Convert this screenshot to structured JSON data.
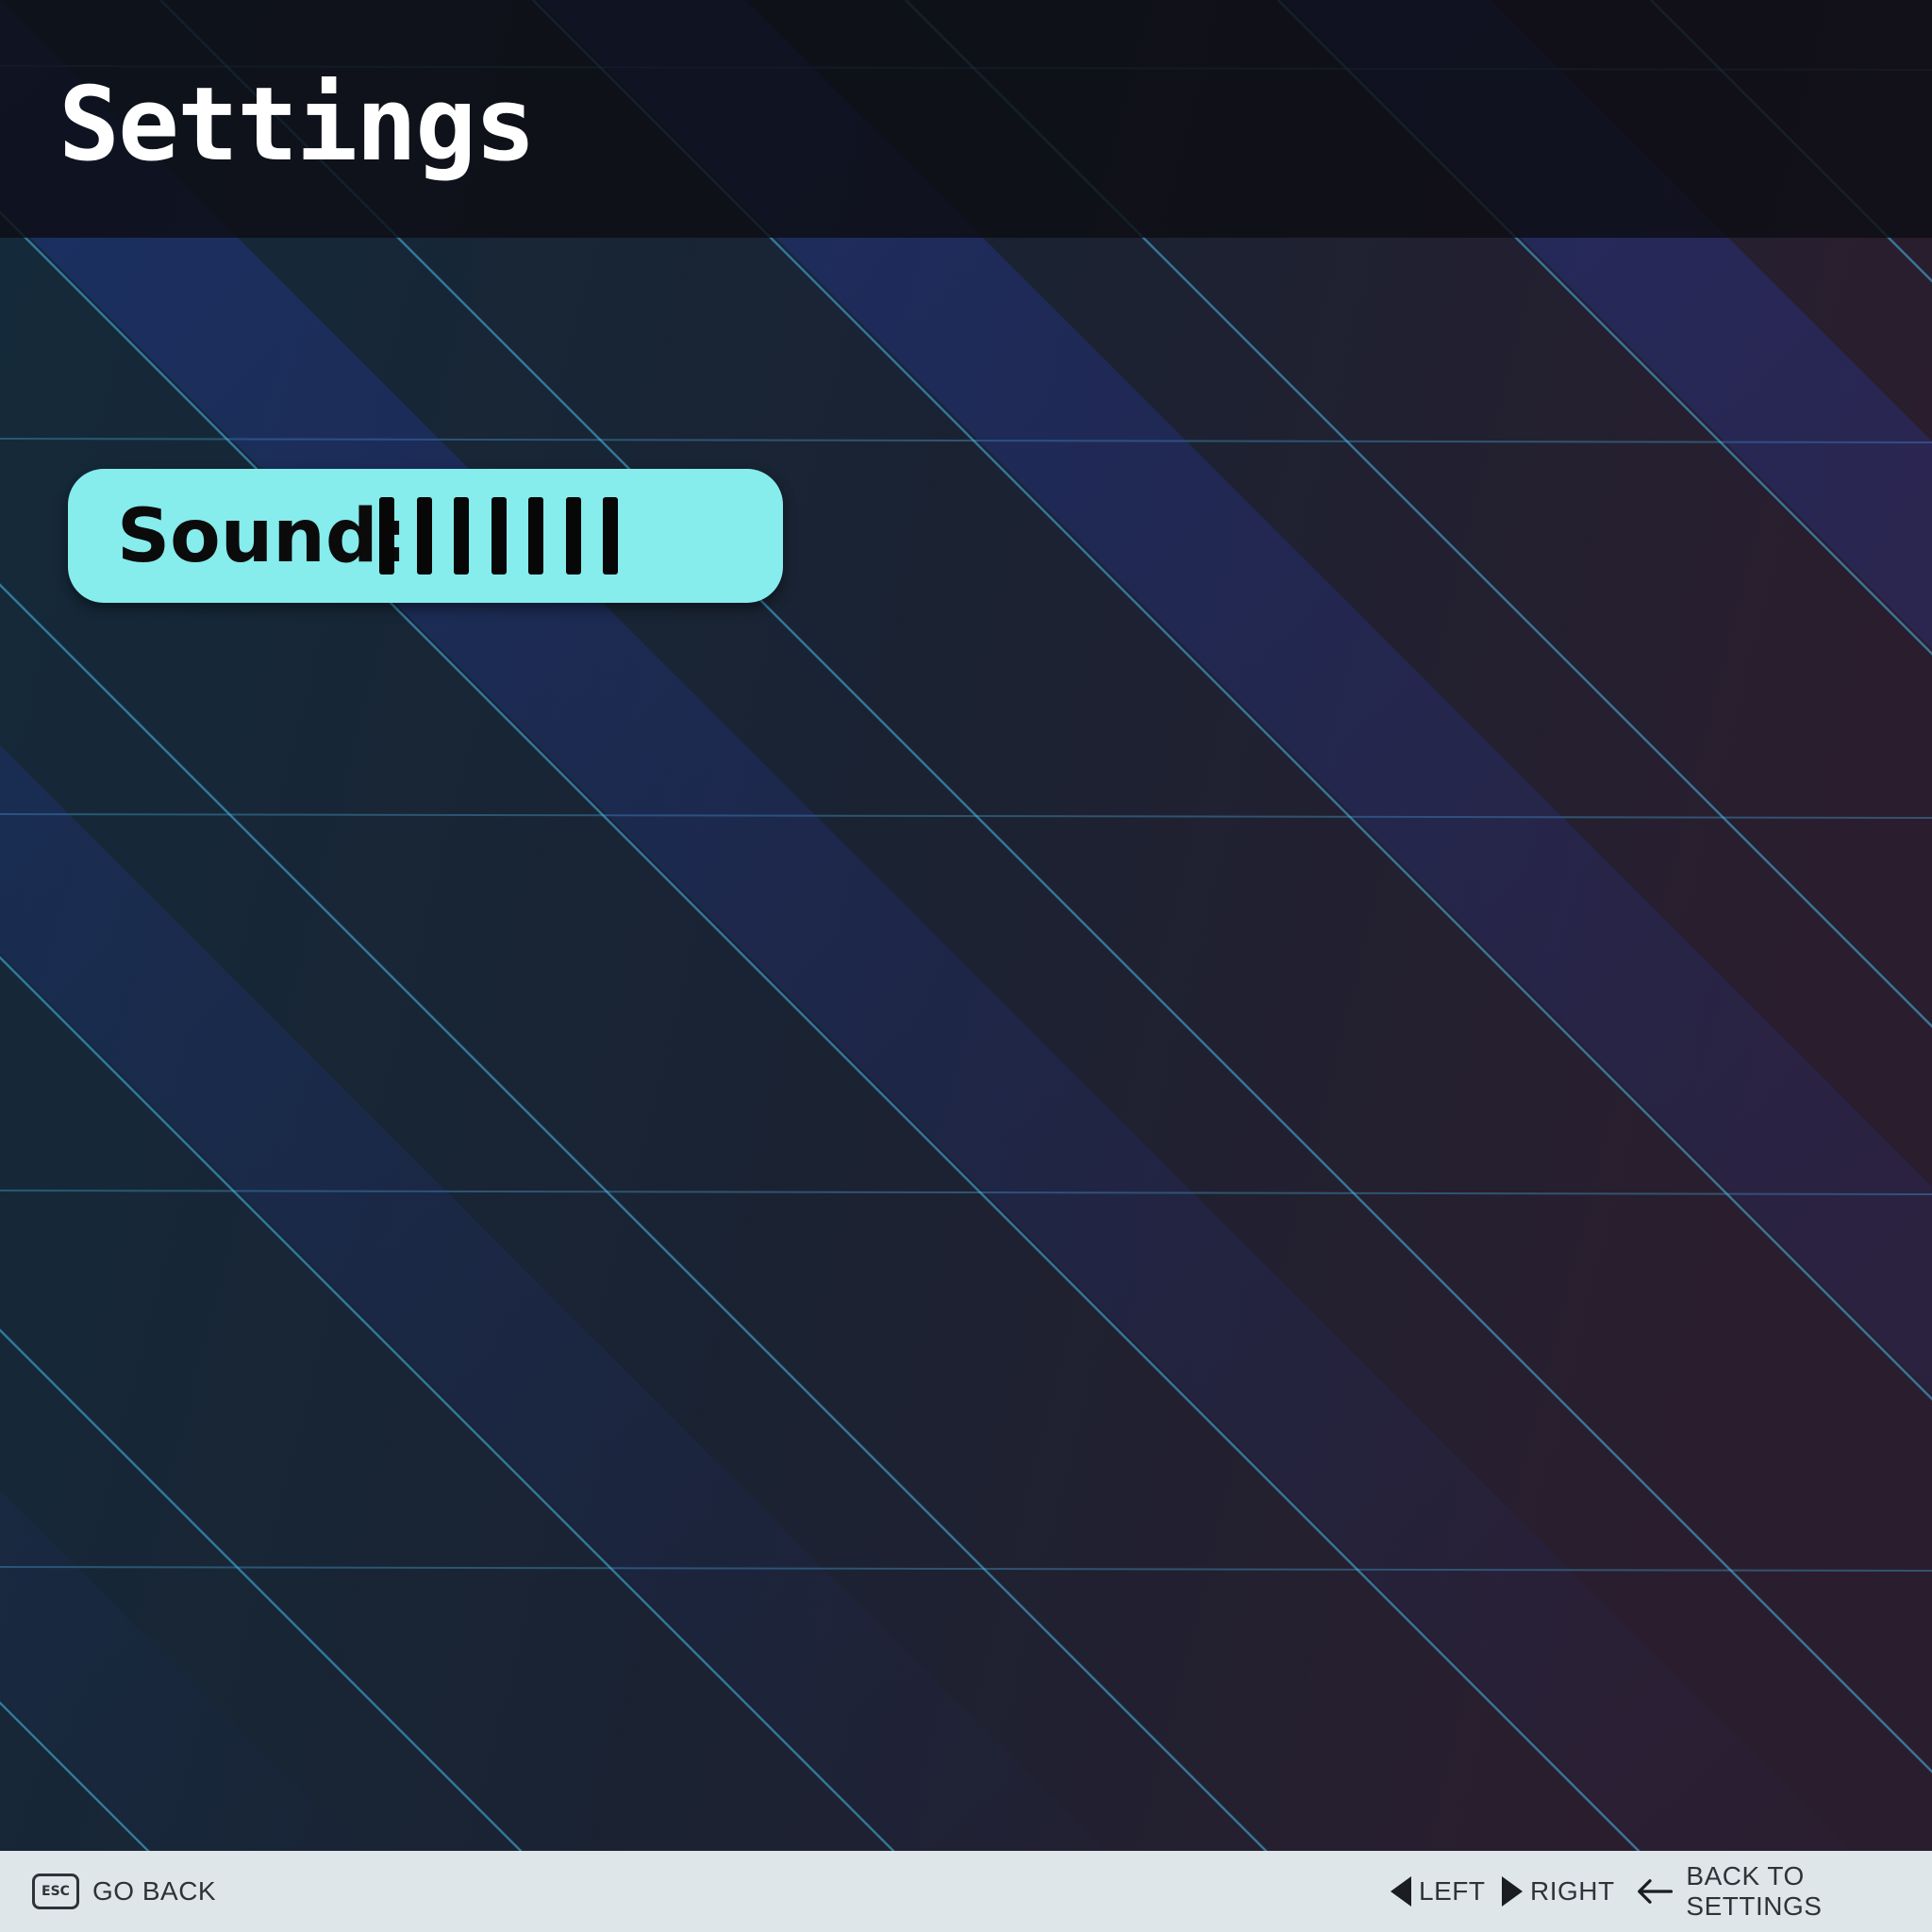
{
  "header": {
    "title": "Settings"
  },
  "settings": {
    "sound": {
      "label": "Sound:",
      "level": 7,
      "max": 10
    }
  },
  "footer": {
    "esc_key": "ESC",
    "go_back": "GO BACK",
    "left": "LEFT",
    "right": "RIGHT",
    "back_to_settings": "BACK TO SETTINGS"
  },
  "colors": {
    "header_bg": "#0e0e14",
    "row_highlight": "#86ecec",
    "footer_bg": "#dfe6ea",
    "footer_text": "#2f3338",
    "accent_cyan": "#4cc9ff",
    "accent_magenta": "#ff2bb5"
  },
  "icons": {
    "esc": "esc-key-icon",
    "left": "triangle-left-icon",
    "right": "triangle-right-icon",
    "back": "arrow-left-icon"
  }
}
